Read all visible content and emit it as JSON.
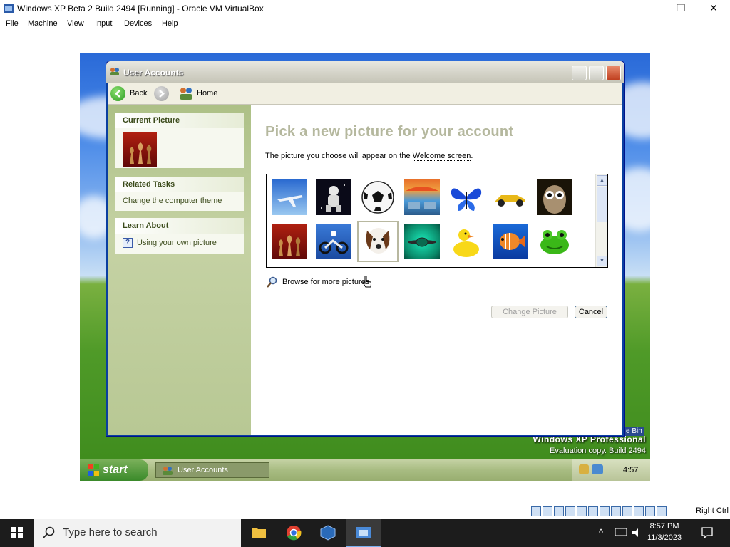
{
  "vbox": {
    "title": "Windows XP Beta 2 Build 2494 [Running] - Oracle VM VirtualBox",
    "menu": [
      "File",
      "Machine",
      "View",
      "Input",
      "Devices",
      "Help"
    ],
    "status_right_ctrl": "Right Ctrl"
  },
  "window": {
    "title": "User Accounts",
    "nav": {
      "back": "Back",
      "home": "Home"
    }
  },
  "sidebar": {
    "current_picture": {
      "header": "Current Picture"
    },
    "related_tasks": {
      "header": "Related Tasks",
      "items": [
        "Change the computer theme"
      ]
    },
    "learn_about": {
      "header": "Learn About",
      "items": [
        "Using your own picture"
      ]
    }
  },
  "main": {
    "heading": "Pick a new picture for your account",
    "desc_prefix": "The picture you choose will appear on the ",
    "desc_link": "Welcome screen",
    "desc_suffix": ".",
    "pictures": [
      "airplane",
      "astronaut",
      "soccer-ball",
      "beach-chairs",
      "butterfly",
      "race-car",
      "owl",
      "chess",
      "dirt-bike",
      "dog",
      "drip",
      "duck",
      "fish",
      "frog"
    ],
    "selected_picture": "dog",
    "browse": "Browse for more pictures",
    "change_button": "Change Picture",
    "cancel_button": "Cancel"
  },
  "desktop": {
    "brand": "Windows XP Professional",
    "build": "Evaluation copy. Build 2494",
    "recycle_bin": "e Bin"
  },
  "xp_taskbar": {
    "start": "start",
    "task": "User Accounts",
    "time": "4:57 PM"
  },
  "host_taskbar": {
    "search_placeholder": "Type here to search",
    "time": "8:57 PM",
    "date": "11/3/2023"
  }
}
